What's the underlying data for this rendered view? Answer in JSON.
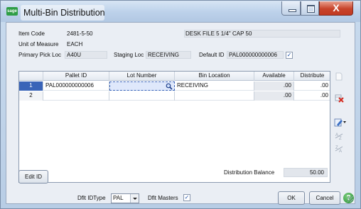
{
  "window": {
    "title": "Multi-Bin Distribution",
    "app_badge": "sage",
    "close_glyph": "X"
  },
  "header": {
    "item_code_label": "Item Code",
    "item_code": "2481-5-50",
    "item_description": "DESK FILE 5 1/4\" CAP 50",
    "uom_label": "Unit of Measure",
    "uom": "EACH",
    "primary_pick_label": "Primary Pick Loc",
    "primary_pick": "A40U",
    "staging_label": "Staging Loc",
    "staging": "RECEIVING",
    "default_id_label": "Default ID",
    "default_id": "PAL000000000006",
    "default_id_checked": true
  },
  "grid": {
    "columns": [
      "",
      "Pallet ID",
      "Lot Number",
      "Bin Location",
      "Available",
      "Distribute"
    ],
    "rows": [
      {
        "num": "1",
        "pallet_id": "PAL000000000006",
        "lot": "",
        "bin": "RECEIVING",
        "available": ".00",
        "distribute": ".00"
      },
      {
        "num": "2",
        "pallet_id": "",
        "lot": "",
        "bin": "",
        "available": ".00",
        "distribute": ".00"
      }
    ]
  },
  "side_toolbar": {
    "icons": [
      "blank-page-icon",
      "delete-row-icon",
      "edit-menu-icon",
      "sort-ascending-icon",
      "sort-descending-icon"
    ]
  },
  "footer": {
    "edit_id_label": "Edit ID",
    "dist_balance_label": "Distribution Balance",
    "dist_balance": "50.00",
    "dflt_id_type_label": "Dflt IDType",
    "dflt_id_type": "PAL",
    "dflt_masters_label": "Dflt Masters",
    "dflt_masters_checked": true,
    "ok_label": "OK",
    "cancel_label": "Cancel",
    "help_glyph": "?"
  },
  "colors": {
    "selected_row": "#3a64b8",
    "close_button": "#c7432a",
    "help_button": "#1e8a2e"
  }
}
